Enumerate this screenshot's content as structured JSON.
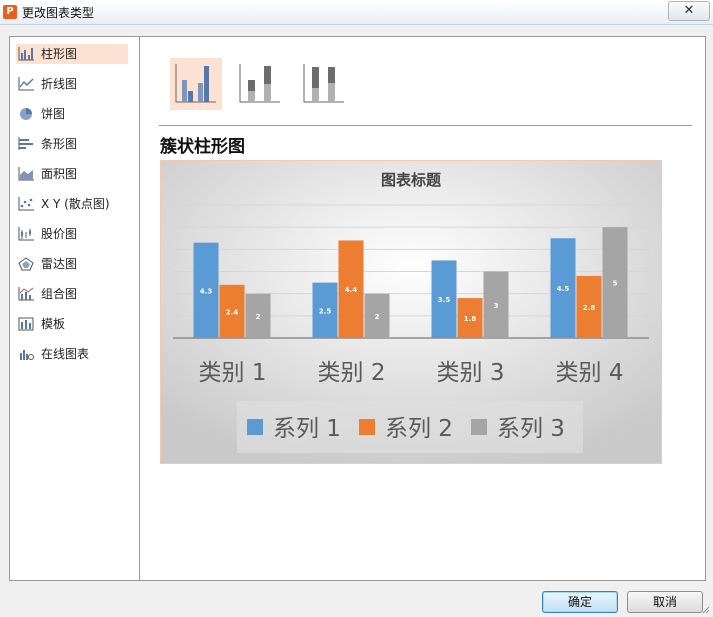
{
  "window": {
    "title": "更改图表类型",
    "close_label": "✕"
  },
  "sidebar": {
    "items": [
      {
        "label": "柱形图",
        "icon": "column-chart-icon",
        "selected": true
      },
      {
        "label": "折线图",
        "icon": "line-chart-icon"
      },
      {
        "label": "饼图",
        "icon": "pie-chart-icon"
      },
      {
        "label": "条形图",
        "icon": "bar-chart-icon"
      },
      {
        "label": "面积图",
        "icon": "area-chart-icon"
      },
      {
        "label": "X Y (散点图)",
        "icon": "scatter-chart-icon"
      },
      {
        "label": "股价图",
        "icon": "stock-chart-icon"
      },
      {
        "label": "雷达图",
        "icon": "radar-chart-icon"
      },
      {
        "label": "组合图",
        "icon": "combo-chart-icon"
      },
      {
        "label": "模板",
        "icon": "template-icon"
      },
      {
        "label": "在线图表",
        "icon": "online-chart-icon"
      }
    ]
  },
  "subtypes": [
    {
      "icon": "clustered-column-icon",
      "selected": true
    },
    {
      "icon": "stacked-column-icon"
    },
    {
      "icon": "percent-stacked-column-icon"
    }
  ],
  "chart_type_name": "簇状柱形图",
  "chart_data": {
    "type": "bar",
    "title": "图表标题",
    "categories": [
      "类别 1",
      "类别 2",
      "类别 3",
      "类别 4"
    ],
    "series": [
      {
        "name": "系列 1",
        "values": [
          4.3,
          2.5,
          3.5,
          4.5
        ],
        "color": "#5b9bd5"
      },
      {
        "name": "系列 2",
        "values": [
          2.4,
          4.4,
          1.8,
          2.8
        ],
        "color": "#ed7d31"
      },
      {
        "name": "系列 3",
        "values": [
          2,
          2,
          3,
          5
        ],
        "color": "#a5a5a5"
      }
    ],
    "ylim": [
      0,
      6
    ],
    "grid": true,
    "legend_position": "bottom"
  },
  "buttons": {
    "ok": "确定",
    "cancel": "取消"
  }
}
